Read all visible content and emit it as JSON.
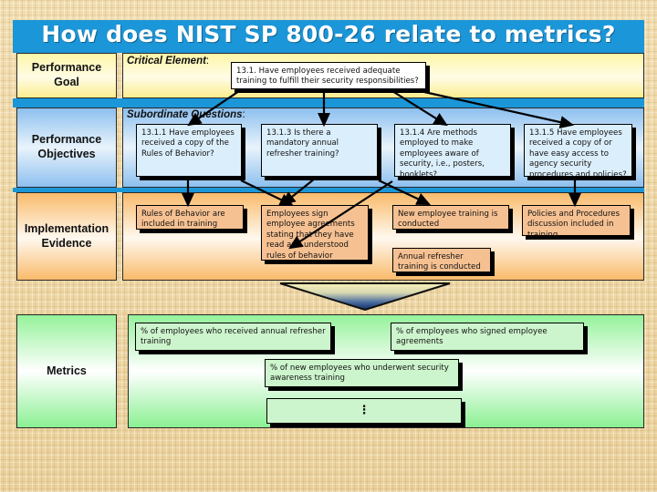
{
  "slide": {
    "title": "How does NIST SP 800-26 relate to metrics?",
    "title_bg": "#1b96d8",
    "title_color": "#ffffff"
  },
  "rows": [
    {
      "label": "Performance\nGoal",
      "label_line1": "Performance",
      "label_line2": "Goal",
      "band_heading": "Critical Element",
      "band_heading_suffix": ":",
      "accent": "#fbec8d"
    },
    {
      "label_line1": "Performance",
      "label_line2": "Objectives",
      "band_heading": "Subordinate Questions",
      "band_heading_suffix": ":",
      "accent": "#8dc0ef"
    },
    {
      "label_line1": "Implementation",
      "label_line2": "Evidence",
      "band_heading": "",
      "band_heading_suffix": "",
      "accent": "#f9bb6b"
    },
    {
      "label_line1": "Metrics",
      "label_line2": "",
      "band_heading": "",
      "band_heading_suffix": "",
      "accent": "#8bf093"
    }
  ],
  "critical_element": {
    "text": "13.1. Have employees received adequate training to fulfill their security responsibilities?"
  },
  "subordinate_questions": [
    {
      "text": "13.1.1 Have employees received a copy of the Rules of Behavior?"
    },
    {
      "text": "13.1.3 Is there a mandatory annual refresher training?"
    },
    {
      "text": "13.1.4 Are methods employed to make employees aware of security, i.e., posters, booklets?"
    },
    {
      "text": "13.1.5 Have employees received a copy of or have easy access to agency security procedures and policies?"
    }
  ],
  "implementation_evidence": [
    {
      "text": "Rules of Behavior are included in training"
    },
    {
      "text": "Employees sign employee agreements stating that they have read and understood rules of behavior"
    },
    {
      "text": "New employee training is conducted"
    },
    {
      "text": "Policies and Procedures discussion included in training"
    },
    {
      "text": "Annual refresher training is conducted"
    }
  ],
  "metrics": [
    {
      "text": "% of employees who received annual refresher training"
    },
    {
      "text": "% of employees who signed employee agreements"
    },
    {
      "text": "% of new employees who underwent security awareness training"
    },
    {
      "text": "⋮"
    }
  ]
}
